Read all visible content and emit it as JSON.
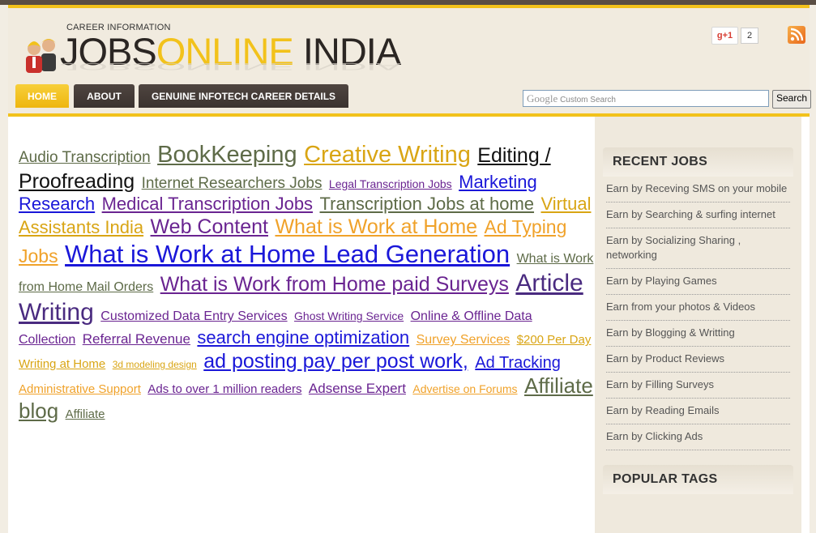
{
  "header": {
    "tagline": "CAREER INFORMATION",
    "logo_part1": "JOBS",
    "logo_part2": "ONLINE",
    "logo_part3": " INDIA",
    "gplus_label": "g+1",
    "gplus_count": "2"
  },
  "nav": {
    "tabs": [
      {
        "label": "HOME"
      },
      {
        "label": "ABOUT"
      },
      {
        "label": "GENUINE INFOTECH CAREER DETAILS"
      }
    ]
  },
  "search": {
    "brand": "Google",
    "placeholder": "Custom Search",
    "button": "Search"
  },
  "colors": {
    "accent": "#f2c21b",
    "tag_green": "#5e6b48",
    "tag_gold": "#d9a514",
    "tag_blue": "#1a17d9",
    "tag_purple": "#6a2491",
    "tag_orange": "#f0a22a",
    "tag_black": "#111111"
  },
  "tags": [
    {
      "text": "Audio Transcription",
      "size": 19,
      "color": "#5e6b48"
    },
    {
      "text": "BookKeeping",
      "size": 29,
      "color": "#5e6b48"
    },
    {
      "text": "Creative Writing",
      "size": 29,
      "color": "#d9a514"
    },
    {
      "text": "Editing / Proofreading",
      "size": 25,
      "color": "#111111"
    },
    {
      "text": "Internet Researchers Jobs",
      "size": 19,
      "color": "#5e6b48"
    },
    {
      "text": "Legal Transcription Jobs",
      "size": 14,
      "color": "#6a2491"
    },
    {
      "text": "Marketing Research",
      "size": 22,
      "color": "#1a17d9"
    },
    {
      "text": "Medical Transcription Jobs",
      "size": 22,
      "color": "#6a2491"
    },
    {
      "text": "Transcription Jobs at home",
      "size": 22,
      "color": "#5e6b48"
    },
    {
      "text": "Virtual Assistants India",
      "size": 22,
      "color": "#d9a514"
    },
    {
      "text": "Web Content",
      "size": 25,
      "color": "#6a2491"
    },
    {
      "text": "What is Work at Home",
      "size": 25,
      "color": "#f0a22a"
    },
    {
      "text": "Ad Typing Jobs",
      "size": 23,
      "color": "#f0a22a"
    },
    {
      "text": "What is Work at Home Lead Generation",
      "size": 31,
      "color": "#1a17d9"
    },
    {
      "text": "What is Work from Home Mail Orders",
      "size": 16,
      "color": "#5e6b48"
    },
    {
      "text": "What is Work from Home paid Surveys",
      "size": 25,
      "color": "#6a2491"
    },
    {
      "text": "Article Writing",
      "size": 30,
      "color": "#4a2b80"
    },
    {
      "text": "Customized Data Entry Services",
      "size": 16,
      "color": "#6a2491"
    },
    {
      "text": "Ghost Writing Service",
      "size": 14,
      "color": "#6a2491"
    },
    {
      "text": "Online & Offline Data Collection",
      "size": 16,
      "color": "#6a2491"
    },
    {
      "text": "Referral Revenue",
      "size": 17,
      "color": "#6a2491"
    },
    {
      "text": "search engine optimization",
      "size": 22,
      "color": "#1a17d9"
    },
    {
      "text": "Survey Services",
      "size": 16,
      "color": "#f0a22a"
    },
    {
      "text": "$200 Per Day Writing at Home",
      "size": 15,
      "color": "#d9a514"
    },
    {
      "text": "3d modeling design",
      "size": 12,
      "color": "#d9a514"
    },
    {
      "text": "ad posting pay per post work,",
      "size": 25,
      "color": "#1a17d9"
    },
    {
      "text": "Ad Tracking",
      "size": 20,
      "color": "#1a17d9"
    },
    {
      "text": "Administrative Support",
      "size": 15,
      "color": "#f0a22a"
    },
    {
      "text": "Ads to over 1 million readers",
      "size": 15,
      "color": "#6a2491"
    },
    {
      "text": "Adsense Expert",
      "size": 17,
      "color": "#6a2491"
    },
    {
      "text": "Advertise on Forums",
      "size": 14,
      "color": "#f0a22a"
    },
    {
      "text": "Affiliate blog",
      "size": 26,
      "color": "#5e6b48"
    },
    {
      "text": "Affiliate",
      "size": 15,
      "color": "#5e6b48"
    }
  ],
  "sidebar": {
    "recent_title": "RECENT JOBS",
    "recent_items": [
      "Earn by Receving SMS on your mobile",
      "Earn by Searching & surfing internet",
      "Earn by Socializing Sharing , networking",
      "Earn by Playing Games",
      "Earn from your photos & Videos",
      "Earn by Blogging & Writting",
      "Earn by Product Reviews",
      "Earn by Filling Surveys",
      "Earn by Reading Emails",
      "Earn by Clicking Ads"
    ],
    "popular_title": "POPULAR TAGS"
  }
}
